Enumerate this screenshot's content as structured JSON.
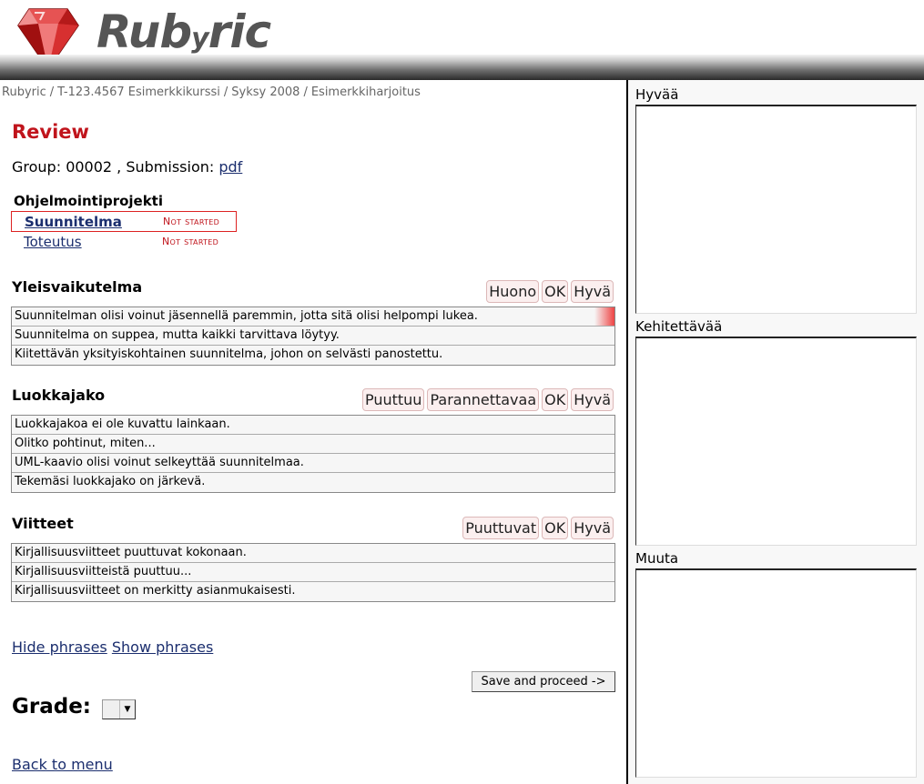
{
  "header": {
    "logo_text_a": "Rub",
    "logo_text_b": "y",
    "logo_text_c": "ric"
  },
  "breadcrumb": [
    "Rubyric",
    "T-123.4567 Esimerkkikurssi",
    "Syksy 2008",
    "Esimerkkiharjoitus"
  ],
  "review": {
    "title": "Review",
    "group_prefix": "Group: 00002 , Submission: ",
    "submission_link": "pdf"
  },
  "rubric_nav": {
    "section_title": "Ohjelmointiprojekti",
    "items": [
      {
        "label": "Suunnitelma",
        "status": "Not started"
      },
      {
        "label": "Toteutus",
        "status": "Not started"
      }
    ]
  },
  "criteria": [
    {
      "title": "Yleisvaikutelma",
      "grades": [
        "Huono",
        "OK",
        "Hyvä"
      ],
      "phrases": [
        "Suunnitelman olisi voinut jäsennellä paremmin, jotta sitä olisi helpompi lukea.",
        "Suunnitelma on suppea, mutta kaikki tarvittava löytyy.",
        "Kiitettävän yksityiskohtainen suunnitelma, johon on selvästi panostettu."
      ]
    },
    {
      "title": "Luokkajako",
      "grades": [
        "Puuttuu",
        "Parannettavaa",
        "OK",
        "Hyvä"
      ],
      "phrases": [
        "Luokkajakoa ei ole kuvattu lainkaan.",
        "Olitko pohtinut, miten...",
        "UML-kaavio olisi voinut selkeyttää suunnitelmaa.",
        "Tekemäsi luokkajako on järkevä."
      ]
    },
    {
      "title": "Viitteet",
      "grades": [
        "Puuttuvat",
        "OK",
        "Hyvä"
      ],
      "phrases": [
        "Kirjallisuusviitteet puuttuvat kokonaan.",
        "Kirjallisuusviitteistä puuttuu...",
        "Kirjallisuusviitteet on merkitty asianmukaisesti."
      ]
    }
  ],
  "links": {
    "hide_phrases": "Hide phrases",
    "show_phrases": "Show phrases",
    "back": "Back to menu"
  },
  "save_button": "Save and proceed ->",
  "grade": {
    "label": "Grade:",
    "selected": ""
  },
  "feedback": {
    "sections": [
      {
        "label": "Hyvää",
        "value": ""
      },
      {
        "label": "Kehitettävää",
        "value": ""
      },
      {
        "label": "Muuta",
        "value": ""
      }
    ]
  }
}
